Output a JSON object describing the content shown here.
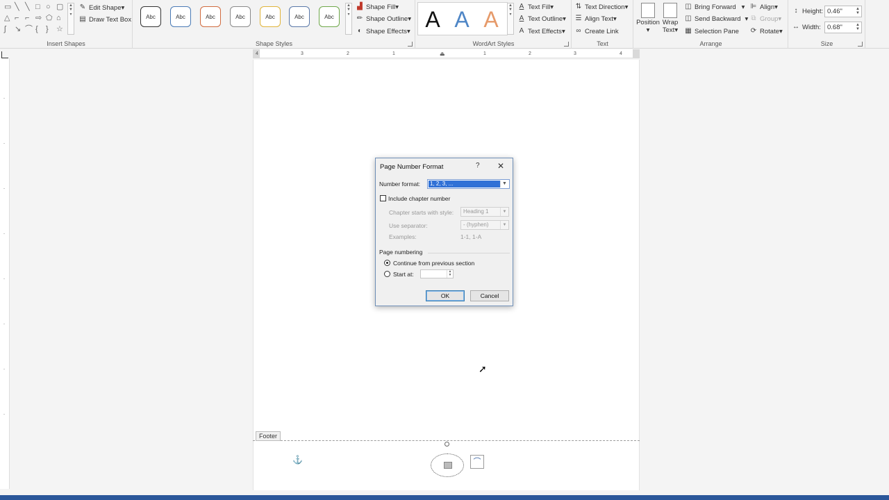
{
  "ribbon": {
    "insert_shapes": {
      "label": "Insert Shapes",
      "edit_shape": "Edit Shape",
      "draw_text_box": "Draw Text Box"
    },
    "shape_styles": {
      "label": "Shape Styles",
      "preset_text": "Abc",
      "presets": [
        {
          "color": "#333333"
        },
        {
          "color": "#4a7ab5"
        },
        {
          "color": "#d06b3f"
        },
        {
          "color": "#8a8a8a"
        },
        {
          "color": "#e0b43a"
        },
        {
          "color": "#5a78a8"
        },
        {
          "color": "#6fa84a"
        }
      ],
      "shape_fill": "Shape Fill",
      "shape_outline": "Shape Outline",
      "shape_effects": "Shape Effects"
    },
    "wordart": {
      "label": "WordArt Styles",
      "letter": "A",
      "letter_colors": [
        "#111111",
        "#4f86c6",
        "#e69a6a"
      ],
      "text_fill": "Text Fill",
      "text_outline": "Text Outline",
      "text_effects": "Text Effects"
    },
    "text": {
      "label": "Text",
      "text_direction": "Text Direction",
      "align_text": "Align Text",
      "create_link": "Create Link"
    },
    "arrange": {
      "label": "Arrange",
      "position": "Position",
      "wrap_text": "Wrap Text",
      "bring_forward": "Bring Forward",
      "send_backward": "Send Backward",
      "selection_pane": "Selection Pane",
      "align": "Align",
      "group": "Group",
      "rotate": "Rotate"
    },
    "size": {
      "label": "Size",
      "height_label": "Height:",
      "height_value": "0.46\"",
      "width_label": "Width:",
      "width_value": "0.68\""
    }
  },
  "ruler": {
    "ticks": [
      "4",
      "3",
      "2",
      "1",
      "1",
      "2",
      "3",
      "4"
    ]
  },
  "document": {
    "footer_label": "Footer"
  },
  "dialog": {
    "title": "Page Number Format",
    "help": "?",
    "close": "✕",
    "number_format_label": "Number format:",
    "number_format_value": "1, 2, 3, ...",
    "include_chapter_label": "Include chapter number",
    "include_chapter_checked": false,
    "chapter_style_label": "Chapter starts with style:",
    "chapter_style_value": "Heading 1",
    "separator_label": "Use separator:",
    "separator_value": "-   (hyphen)",
    "examples_label": "Examples:",
    "examples_value": "1-1, 1-A",
    "page_numbering_label": "Page numbering",
    "continue_label": "Continue from previous section",
    "start_at_label": "Start at:",
    "start_at_value": "",
    "ok": "OK",
    "cancel": "Cancel"
  }
}
